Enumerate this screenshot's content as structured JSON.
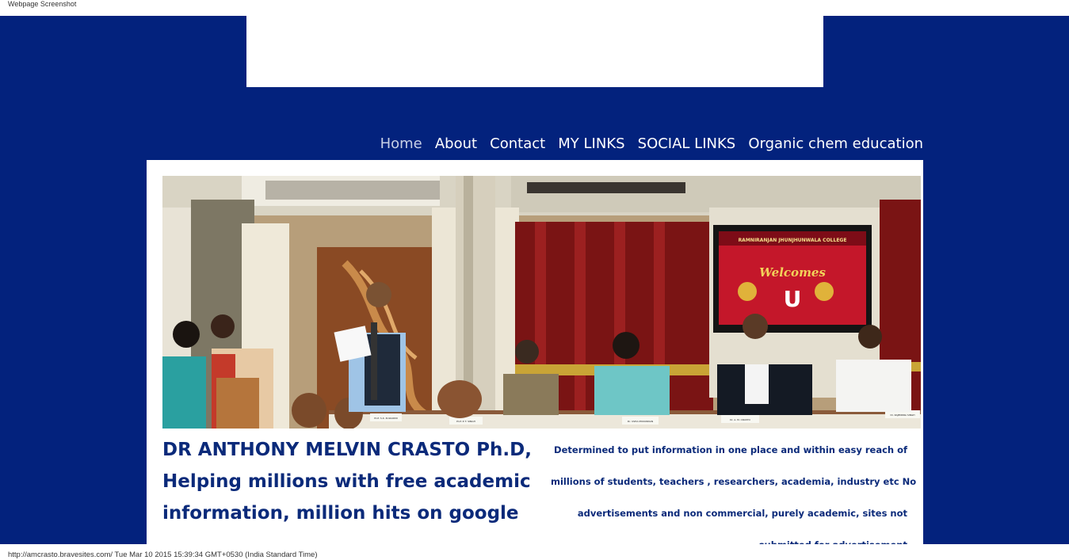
{
  "capture_label": "Webpage Screenshot",
  "nav": {
    "items": [
      {
        "label": "Home"
      },
      {
        "label": "About"
      },
      {
        "label": "Contact"
      },
      {
        "label": "MY LINKS"
      },
      {
        "label": "SOCIAL LINKS"
      },
      {
        "label": "Organic chem education"
      }
    ]
  },
  "hero": {
    "screen_line1": "Welcomes",
    "screen_letter": "U",
    "screen_header": "RAMNIRANJAN JHUNJHUNWALA COLLEGE",
    "name_plates": [
      "Prof. S.K. KULKARNI",
      "Prof. P. T. SINGH",
      "Dr. USHA MUKUNDAN",
      "Dr. A. M. CRASTO",
      "Dr. RAJENDRA SINGH"
    ]
  },
  "headline": {
    "line1": "DR ANTHONY MELVIN CRASTO Ph.D,",
    "line2": "Helping millions with free academic",
    "line3": "information, million hits on google"
  },
  "blurb": {
    "line1": "Determined to put information in one place and within easy reach of",
    "line2": "millions of students, teachers , researchers, academia, industry etc No",
    "line3": "advertisements and non commercial, purely academic, sites not",
    "line4": "submitted for advertisement"
  },
  "status_line": "http://amcrasto.bravesites.com/ Tue Mar 10 2015 15:39:34 GMT+0530 (India Standard Time)",
  "colors": {
    "page_background": "#03227d",
    "heading_text": "#0b2a7a",
    "nav_text": "#ffffff",
    "nav_active": "#c8d0e6"
  }
}
